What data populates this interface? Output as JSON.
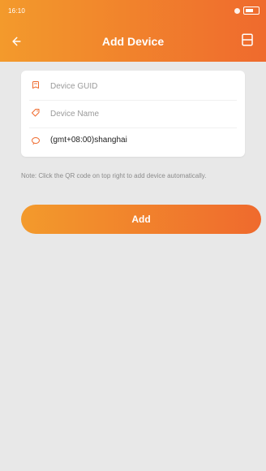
{
  "status_bar": {
    "time": "16:10"
  },
  "header": {
    "title": "Add Device"
  },
  "form": {
    "device_guid_placeholder": "Device GUID",
    "device_name_placeholder": "Device Name",
    "timezone_value": "(gmt+08:00)shanghai"
  },
  "note": {
    "text": "Note: Click the QR code on top right to add device automatically."
  },
  "actions": {
    "add_label": "Add"
  },
  "colors": {
    "accent": "#ef6a2d",
    "accent_light": "#f39a2c"
  }
}
